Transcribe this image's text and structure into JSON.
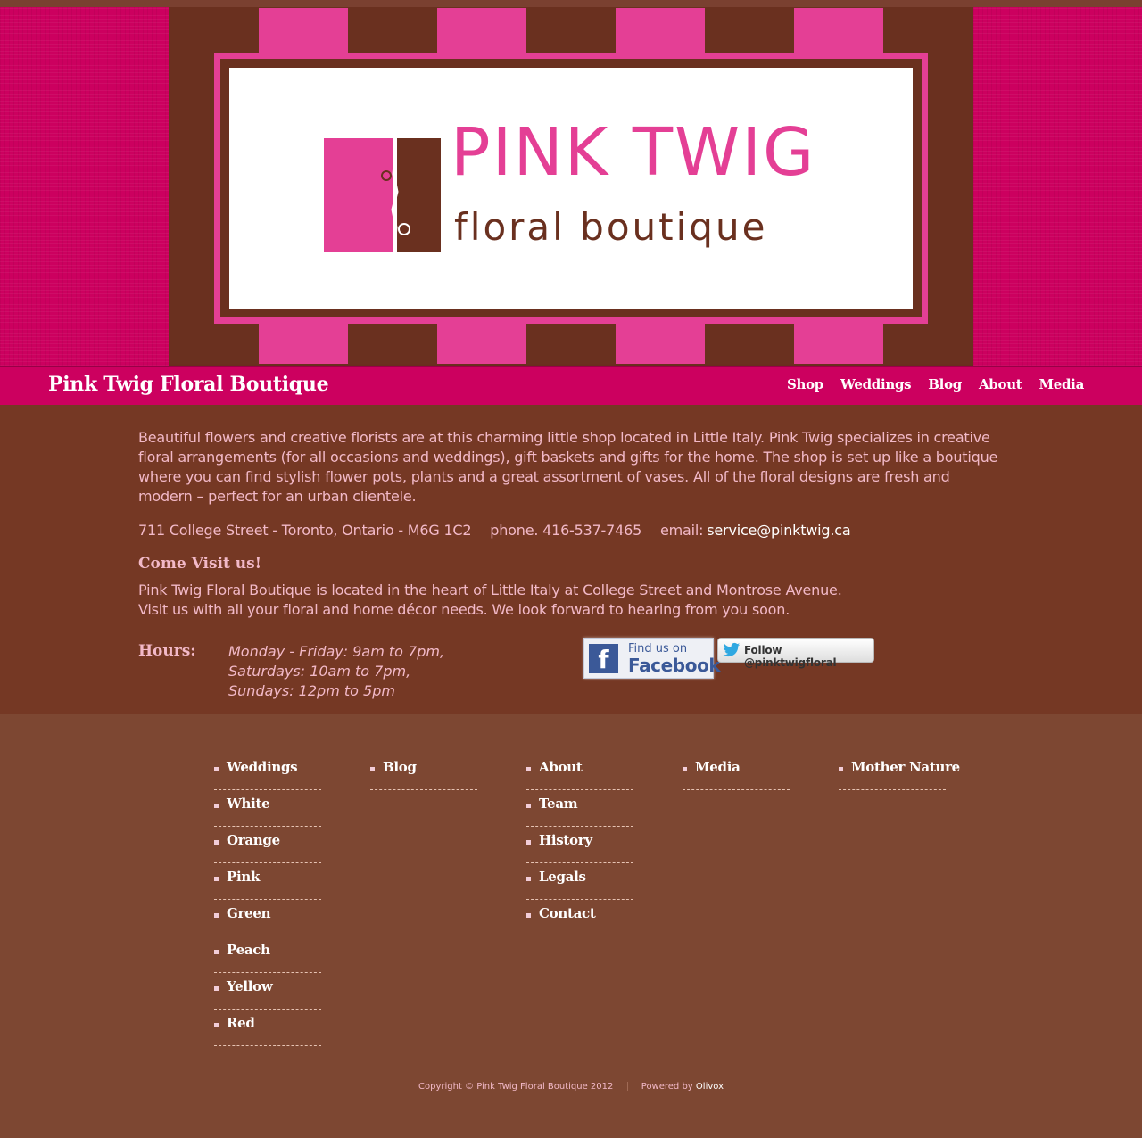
{
  "colors": {
    "brand_pink": "#cc005f",
    "light_pink": "#e43f95",
    "brown": "#6a301f",
    "content_bg": "#753824",
    "footer_bg": "#7d4732",
    "text_pink": "#f2b9c8"
  },
  "logo": {
    "title": "PINK TWIG",
    "subtitle": "floral boutique"
  },
  "nav": {
    "brand": "Pink Twig Floral Boutique",
    "links": [
      "Shop",
      "Weddings",
      "Blog",
      "About",
      "Media"
    ]
  },
  "content": {
    "intro": "Beautiful flowers and creative florists are at this charming little shop located in Little Italy. Pink Twig specializes in creative floral arrangements (for all occasions and weddings), gift baskets and gifts for the home. The shop is set up like a boutique where you can find stylish flower pots, plants and a great assortment of vases. All of the floral designs are fresh and modern – perfect for an urban clientele.",
    "address": "711 College Street - Toronto, Ontario - M6G 1C2",
    "phone": "phone. 416-537-7465",
    "email_label": "email:",
    "email": "service@pinktwig.ca",
    "visit_title": "Come Visit us!",
    "visit_line1": "Pink Twig Floral Boutique is located in the heart of Little Italy at College Street and Montrose Avenue.",
    "visit_line2": "Visit us with all your floral and home décor needs. We look forward to hearing from you soon.",
    "hours_label": "Hours:",
    "hours": [
      "Monday - Friday: 9am to 7pm,",
      "Saturdays: 10am to 7pm,",
      "Sundays: 12pm to 5pm"
    ]
  },
  "social": {
    "facebook_line1": "Find us on",
    "facebook_line2": "Facebook",
    "facebook_icon": "facebook-icon",
    "twitter_label": "Follow @pinktwigfloral",
    "twitter_icon": "twitter-bird-icon"
  },
  "footer": {
    "columns": [
      [
        "Weddings",
        "White",
        "Orange",
        "Pink",
        "Green",
        "Peach",
        "Yellow",
        "Red"
      ],
      [
        "Blog"
      ],
      [
        "About",
        "Team",
        "History",
        "Legals",
        "Contact"
      ],
      [
        "Media"
      ],
      [
        "Mother Nature"
      ]
    ],
    "copyright": "Copyright © Pink Twig Floral Boutique 2012",
    "powered_by_label": "Powered by",
    "powered_by": "Olivox"
  }
}
